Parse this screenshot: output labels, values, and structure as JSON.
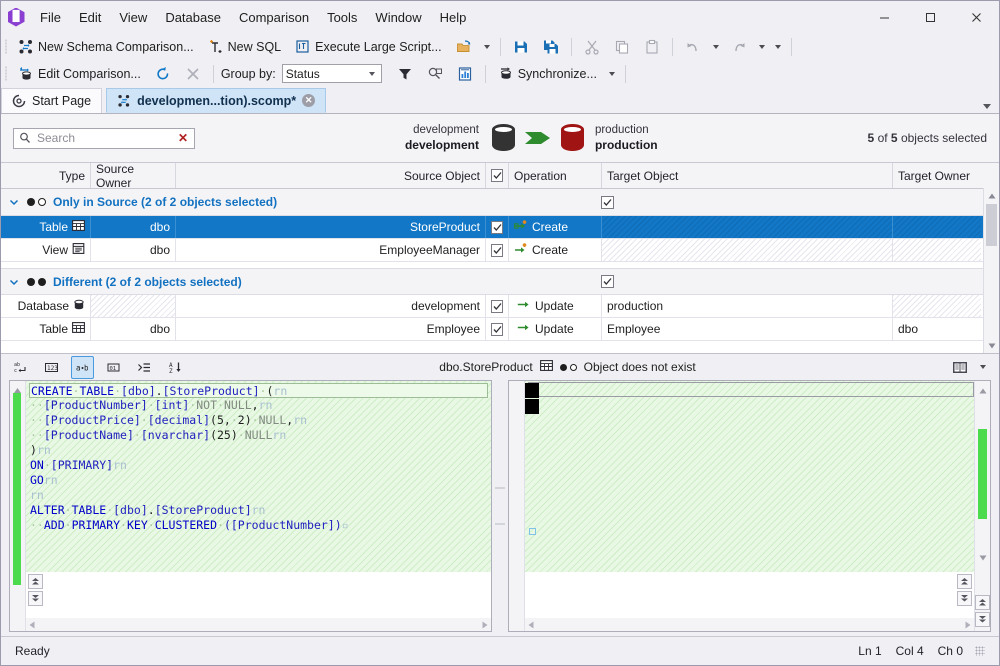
{
  "window": {
    "menus": [
      "File",
      "Edit",
      "View",
      "Database",
      "Comparison",
      "Tools",
      "Window",
      "Help"
    ],
    "minimize_label": "—",
    "maximize_label": "□",
    "close_label": "✕"
  },
  "toolbar1": {
    "new_schema_comparison": "New Schema Comparison...",
    "new_sql": "New SQL",
    "execute_large_script": "Execute Large Script..."
  },
  "toolbar2": {
    "edit_comparison": "Edit Comparison...",
    "group_by_label": "Group by:",
    "group_by_value": "Status",
    "synchronize": "Synchronize..."
  },
  "tabs": [
    {
      "label": "Start Page",
      "active": false,
      "closable": false
    },
    {
      "label": "developmen...tion).scomp*",
      "active": true,
      "closable": true,
      "close_label": "✕"
    }
  ],
  "search": {
    "placeholder": "Search",
    "value": "",
    "clear_label": "✕"
  },
  "comparison": {
    "source": {
      "server": "development",
      "database": "development",
      "color": "#333333"
    },
    "target": {
      "server": "production",
      "database": "production",
      "color": "#a01414"
    },
    "arrow_color": "#2e8b2e",
    "selection_summary_pre": "5",
    "selection_summary_mid": " of ",
    "selection_summary_count": "5",
    "selection_summary_post": " objects selected"
  },
  "grid": {
    "columns": [
      "Type",
      "Source Owner",
      "Source Object",
      "",
      "Operation",
      "Target Object",
      "Target Owner"
    ],
    "groups": [
      {
        "title": "Only in Source (2 of 2 objects selected)",
        "dots": [
          "filled",
          "hollow"
        ],
        "checked": true,
        "rows": [
          {
            "type": "Table",
            "type_icon": "table-icon",
            "source_owner": "dbo",
            "source_object": "StoreProduct",
            "checked": true,
            "operation": "Create",
            "operation_icon": "create-icon",
            "target_object": "",
            "target_owner": "",
            "selected": true,
            "target_hatched": true
          },
          {
            "type": "View",
            "type_icon": "view-icon",
            "source_owner": "dbo",
            "source_object": "EmployeeManager",
            "checked": true,
            "operation": "Create",
            "operation_icon": "create-icon",
            "target_object": "",
            "target_owner": "",
            "selected": false,
            "target_hatched": true
          }
        ]
      },
      {
        "title": "Different (2 of 2 objects selected)",
        "dots": [
          "filled",
          "filled"
        ],
        "checked": true,
        "rows": [
          {
            "type": "Database",
            "type_icon": "database-icon",
            "source_owner": "",
            "source_object": "development",
            "checked": true,
            "operation": "Update",
            "operation_icon": "update-icon",
            "target_object": "production",
            "target_owner": "",
            "selected": false,
            "owner_hatched": true,
            "target_owner_hatched": true
          },
          {
            "type": "Table",
            "type_icon": "table-icon",
            "source_owner": "dbo",
            "source_object": "Employee",
            "checked": true,
            "operation": "Update",
            "operation_icon": "update-icon",
            "target_object": "Employee",
            "target_owner": "dbo",
            "selected": false
          }
        ]
      }
    ]
  },
  "sqlpanel": {
    "buttons": [
      {
        "name": "word-wrap-toggle",
        "glyph": "ab↵",
        "active": false
      },
      {
        "name": "line-numbers-toggle",
        "glyph": "123",
        "active": false
      },
      {
        "name": "whitespace-toggle",
        "glyph": "a·b",
        "active": true
      },
      {
        "name": "hex-view-toggle",
        "glyph": "01",
        "active": false
      },
      {
        "name": "indent-toggle",
        "glyph": "≡",
        "active": false
      },
      {
        "name": "sort-toggle",
        "glyph": "A↓",
        "active": false
      }
    ],
    "object_name": "dbo.StoreProduct",
    "object_status": "Object does not exist",
    "status_dots": [
      "filled",
      "hollow"
    ],
    "left_code_lines": [
      [
        {
          "t": "CREATE",
          "c": "k"
        },
        {
          "t": "·",
          "c": "ws"
        },
        {
          "t": "TABLE",
          "c": "k"
        },
        {
          "t": "·",
          "c": "ws"
        },
        {
          "t": "[dbo]",
          "c": "br"
        },
        {
          "t": ".",
          "c": "num"
        },
        {
          "t": "[StoreProduct]",
          "c": "br"
        },
        {
          "t": "·",
          "c": "ws"
        },
        {
          "t": "(",
          "c": "num"
        },
        {
          "t": "rn",
          "c": "rn"
        }
      ],
      [
        {
          "t": "··",
          "c": "ws"
        },
        {
          "t": "[ProductNumber]",
          "c": "br"
        },
        {
          "t": "·",
          "c": "ws"
        },
        {
          "t": "[int]",
          "c": "br"
        },
        {
          "t": "·",
          "c": "ws"
        },
        {
          "t": "NOT",
          "c": "nul"
        },
        {
          "t": "·",
          "c": "ws"
        },
        {
          "t": "NULL",
          "c": "nul"
        },
        {
          "t": ",",
          "c": "num"
        },
        {
          "t": "rn",
          "c": "rn"
        }
      ],
      [
        {
          "t": "··",
          "c": "ws"
        },
        {
          "t": "[ProductPrice]",
          "c": "br"
        },
        {
          "t": "·",
          "c": "ws"
        },
        {
          "t": "[decimal]",
          "c": "br"
        },
        {
          "t": "(5,",
          "c": "num"
        },
        {
          "t": "·",
          "c": "ws"
        },
        {
          "t": "2)",
          "c": "num"
        },
        {
          "t": "·",
          "c": "ws"
        },
        {
          "t": "NULL",
          "c": "nul"
        },
        {
          "t": ",",
          "c": "num"
        },
        {
          "t": "rn",
          "c": "rn"
        }
      ],
      [
        {
          "t": "··",
          "c": "ws"
        },
        {
          "t": "[ProductName]",
          "c": "br"
        },
        {
          "t": "·",
          "c": "ws"
        },
        {
          "t": "[nvarchar]",
          "c": "br"
        },
        {
          "t": "(25)",
          "c": "num"
        },
        {
          "t": "·",
          "c": "ws"
        },
        {
          "t": "NULL",
          "c": "nul"
        },
        {
          "t": "rn",
          "c": "rn"
        }
      ],
      [
        {
          "t": ")",
          "c": "num"
        },
        {
          "t": "rn",
          "c": "rn"
        }
      ],
      [
        {
          "t": "ON",
          "c": "k"
        },
        {
          "t": "·",
          "c": "ws"
        },
        {
          "t": "[PRIMARY]",
          "c": "br"
        },
        {
          "t": "rn",
          "c": "rn"
        }
      ],
      [
        {
          "t": "GO",
          "c": "k"
        },
        {
          "t": "rn",
          "c": "rn"
        }
      ],
      [
        {
          "t": "rn",
          "c": "rn"
        }
      ],
      [
        {
          "t": "ALTER",
          "c": "k"
        },
        {
          "t": "·",
          "c": "ws"
        },
        {
          "t": "TABLE",
          "c": "k"
        },
        {
          "t": "·",
          "c": "ws"
        },
        {
          "t": "[dbo]",
          "c": "br"
        },
        {
          "t": ".",
          "c": "num"
        },
        {
          "t": "[StoreProduct]",
          "c": "br"
        },
        {
          "t": "rn",
          "c": "rn"
        }
      ],
      [
        {
          "t": "··",
          "c": "ws"
        },
        {
          "t": "ADD",
          "c": "k"
        },
        {
          "t": "·",
          "c": "ws"
        },
        {
          "t": "PRIMARY",
          "c": "k"
        },
        {
          "t": "·",
          "c": "ws"
        },
        {
          "t": "KEY",
          "c": "k"
        },
        {
          "t": "·",
          "c": "ws"
        },
        {
          "t": "CLUSTERED",
          "c": "k"
        },
        {
          "t": "·",
          "c": "ws"
        },
        {
          "t": "([ProductNumber])",
          "c": "br"
        },
        {
          "t": "▫",
          "c": "rn"
        }
      ]
    ],
    "right_code_lines": []
  },
  "statusbar": {
    "message": "Ready",
    "line": "Ln 1",
    "column": "Col 4",
    "chars": "Ch 0"
  }
}
